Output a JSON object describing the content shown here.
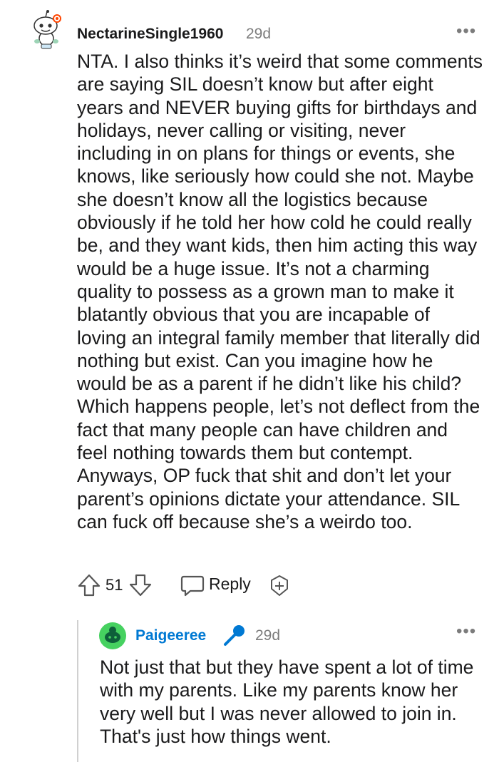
{
  "comment": {
    "username": "NectarineSingle1960",
    "age": "29d",
    "more_label": "•••",
    "body": "NTA. I also thinks it’s weird that some comments are saying SIL doesn’t know but after eight years and NEVER buying gifts for birthdays and holidays, never calling or visiting, never including in on plans for things or events, she knows, like seriously how could she not. Maybe she doesn’t know all the logistics because obviously if he told her how cold he could really be, and they want kids, then him acting this way would be a huge issue. It’s not a charming quality to possess as a grown man to make it blatantly obvious that you are incapable of loving an integral family member that literally did nothing but exist. Can you imagine how he would be as a parent if he didn’t like his child? Which happens people, let’s not deflect from the fact that many people can have children and feel nothing towards them but contempt. Anyways, OP fuck that shit and don’t let your parent’s opinions dictate your attendance. SIL can fuck off because she’s a weirdo too.",
    "score": "51",
    "reply_label": "Reply",
    "avatar_icon": "snoo-avatar-icon",
    "upvote_icon": "upvote-arrow-icon",
    "downvote_icon": "downvote-arrow-icon",
    "reply_icon": "speech-bubble-icon",
    "award_icon": "award-plus-icon"
  },
  "reply": {
    "username": "Paigeeree",
    "age": "29d",
    "more_label": "•••",
    "body": "Not just that but they have spent a lot of time with my parents. Like my parents know her very well but I was never allowed to join in. That's just how things went.",
    "badge_icon": "microphone-icon",
    "avatar_icon": "snoo-avatar-icon",
    "username_color": "#0079d3",
    "avatar_color": "#46d160"
  }
}
